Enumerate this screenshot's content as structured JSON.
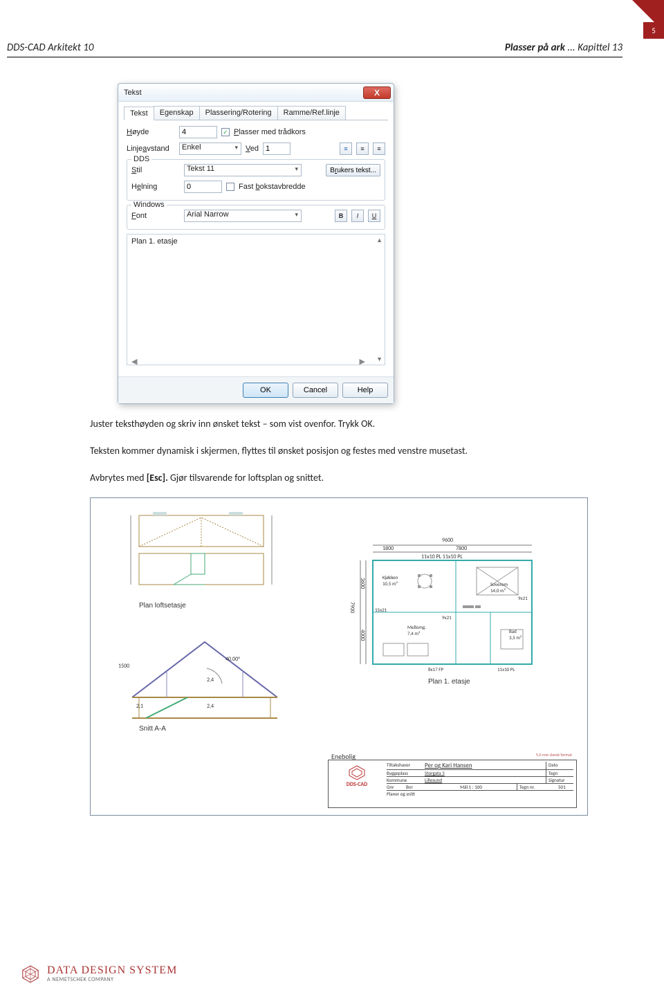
{
  "page": {
    "number": "5",
    "header_left": "DDS-CAD Arkitekt 10",
    "header_right_bold": "Plasser på ark",
    "header_right_rest": " ... Kapittel 13"
  },
  "dialog": {
    "title": "Tekst",
    "tabs": [
      "Tekst",
      "Egenskap",
      "Plassering/Rotering",
      "Ramme/Ref.linje"
    ],
    "active_tab": 0,
    "hoyde_label": "Høyde",
    "hoyde_value": "4",
    "plasser_checked": true,
    "plasser_label": "Plasser med trådkors",
    "linje_label": "Linjeavstand",
    "linje_value": "Enkel",
    "ved_label": "Ved",
    "ved_value": "1",
    "group_dds_label": "DDS",
    "stil_label": "Stil",
    "stil_value": "Tekst 11",
    "helning_label": "Helning",
    "helning_value": "0",
    "fast_label": "Fast bokstavbredde",
    "brukers_label": "Brukers tekst...",
    "group_win_label": "Windows",
    "font_label": "Font",
    "font_value": "Arial Narrow",
    "preview_text": "Plan 1. etasje",
    "ok": "OK",
    "cancel": "Cancel",
    "help": "Help"
  },
  "body_text": {
    "p1": "Juster teksthøyden og skriv inn ønsket tekst – som vist ovenfor. Trykk OK.",
    "p2": "Teksten kommer dynamisk i skjermen, flyttes til ønsket posisjon og festes med venstre musetast.",
    "p3a": "Avbrytes med ",
    "p3b": "[Esc].",
    "p3c": "   Gjør tilsvarende for loftsplan og snittet."
  },
  "drawing": {
    "loft_label": "Plan loftsetasje",
    "floor_label": "Plan 1. etasje",
    "section_label": "Snitt A-A",
    "angle": "40.00°",
    "h1": "2,4",
    "h2": "2,4",
    "h3": "2,1",
    "dim_left": "1500",
    "dim_9600": "9600",
    "dim_1800": "1800",
    "dim_7800": "7800",
    "dim_7900": "7900",
    "dim_3600": "3600",
    "dim_4000": "4000",
    "note1": "11x10 PL 11x10 PL",
    "note2": "8x17 FP",
    "note3": "11x10 PL",
    "room1": "Kjøkken\n10,5 m²",
    "room2": "Mellomg.\n7,4 m²",
    "room3": "Soverom\n14,0 m²",
    "room4": "Bad\n3,5 m²",
    "door1": "15x21",
    "door2": "9x21",
    "door3": "9x21",
    "title_proj": "Enebolig",
    "title_logo": "DDS-CAD",
    "title_owner_lab": "Tiltakshaver",
    "title_owner": "Per og Kari Hansen",
    "title_addr_lab": "Byggeplass",
    "title_addr": "Storgata 3",
    "title_komm_lab": "Kommune",
    "title_komm": "Lillesund",
    "title_gnr": "Gnr",
    "title_bnr": "Bnr",
    "title_scale": "Mål   1 : 100",
    "title_sheet": "Planer og snitt",
    "title_dato": "Dato",
    "title_sign": "Signatur",
    "title_tegn_lab": "Tegn nr.",
    "title_tegn": "501",
    "corner_note": "5.0 mm dansk format"
  },
  "footer": {
    "company_main": "DATA DESIGN SYSTEM",
    "company_sub": "A NEMETSCHEK COMPANY"
  }
}
